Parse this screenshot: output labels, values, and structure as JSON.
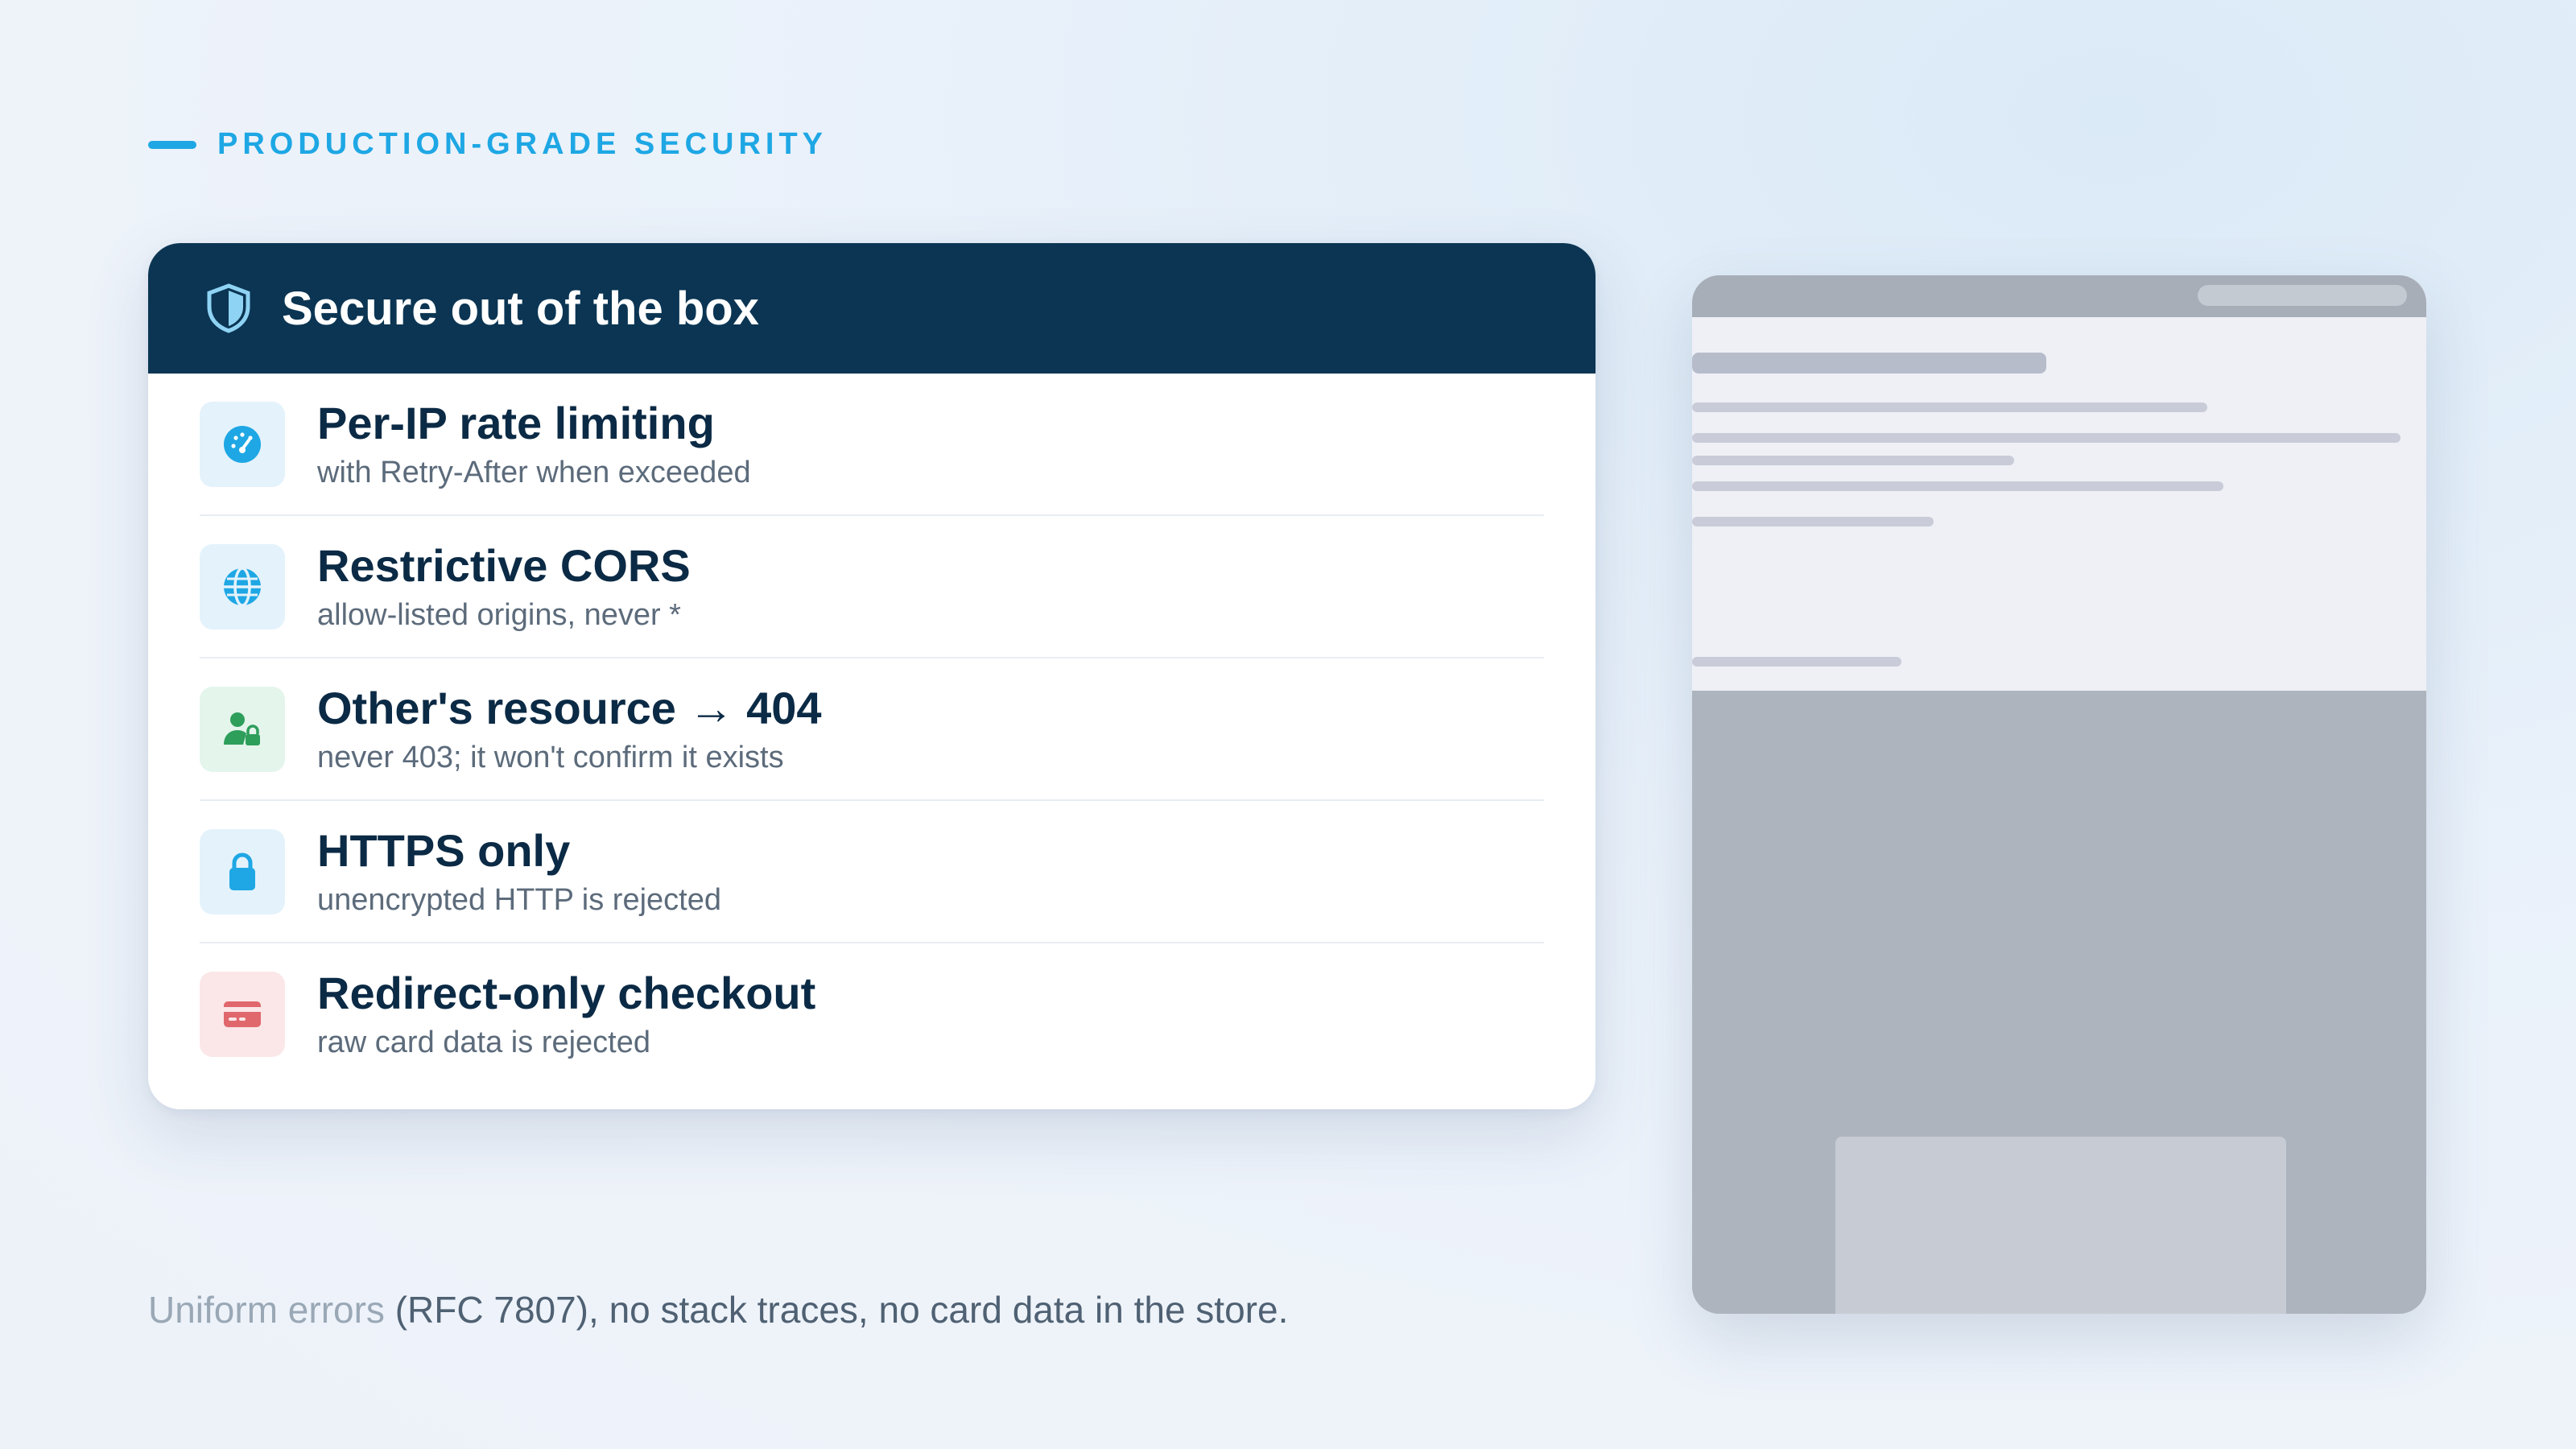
{
  "eyebrow": {
    "label": "PRODUCTION-GRADE SECURITY"
  },
  "card": {
    "title": "Secure out of the box",
    "items": [
      {
        "title": "Per-IP rate limiting",
        "subtitle": "with Retry-After when exceeded",
        "icon": "gauge-icon",
        "color": "#1ea7e4"
      },
      {
        "title": "Restrictive CORS",
        "subtitle": "allow-listed origins, never *",
        "icon": "globe-icon",
        "color": "#1ea7e4"
      },
      {
        "title": "Other's resource → 404",
        "subtitle": "never 403; it won't confirm it exists",
        "icon": "user-lock-icon",
        "color": "#2e9e5b"
      },
      {
        "title": "HTTPS only",
        "subtitle": "unencrypted HTTP is rejected",
        "icon": "lock-icon",
        "color": "#1ea7e4"
      },
      {
        "title": "Redirect-only checkout",
        "subtitle": "raw card data is rejected",
        "icon": "credit-card-icon",
        "color": "#e0676c"
      }
    ]
  },
  "footnote": {
    "muted": "Uniform errors",
    "main": " (RFC 7807), no stack traces, no card data in the store."
  },
  "colors": {
    "accent": "#1ea7e4",
    "header_bg": "#0b3553",
    "title_text": "#0b2a45",
    "subtitle_text": "#5c6b7b"
  }
}
